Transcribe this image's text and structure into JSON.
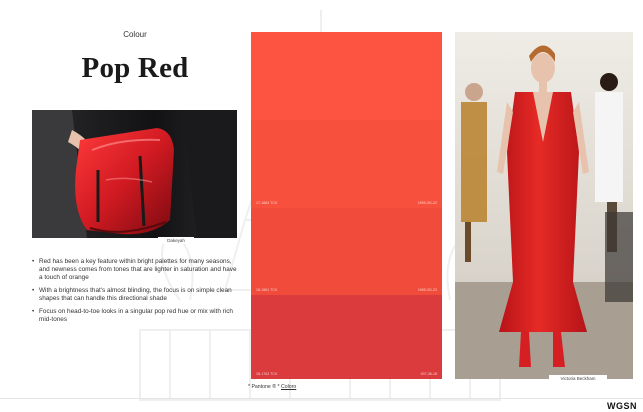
{
  "page": {
    "category": "Colour",
    "title": "Pop Red",
    "brand": "WGSN"
  },
  "bag_photo": {
    "credit": "Dakeyah",
    "alt": "Close-up of a glossy red leather handbag held against a black outfit"
  },
  "bullets": [
    "Red has been a key feature within bright palettes for many seasons, and newness comes from tones that are lighter in saturation and have a touch of orange",
    "With a brightness that's almost blinding, the focus is on simple clean shapes that can handle this directional shade",
    "Focus on head-to-toe looks in a singular pop red hue or mix with rich mid-tones"
  ],
  "swatches": [
    {
      "color": "#fc5440",
      "code_left": "",
      "code_right": ""
    },
    {
      "color": "#f7513e",
      "code_left": "17-1664 TCX",
      "code_right": "1999-3G-22"
    },
    {
      "color": "#f04b3b",
      "code_left": "18-1561 TCX",
      "code_right": "1999-3G-23"
    },
    {
      "color": "#e74439",
      "code_left": "17-1564 TCX",
      "code_right": "1999-3G-24"
    },
    {
      "color": "#dc3b3d",
      "code_left": "18-1763 TCX",
      "code_right": "007-36-18"
    }
  ],
  "swatch_footnote": {
    "prefix": "* Pantone ® *",
    "link": "Coloro"
  },
  "runway_photo": {
    "credit": "Victoria Beckham",
    "alt": "Runway model wearing a red sleeveless V-neck maxi dress with red boots"
  },
  "colors": {
    "pop_red": "#e92b25",
    "bag_red": "#d11a22"
  }
}
